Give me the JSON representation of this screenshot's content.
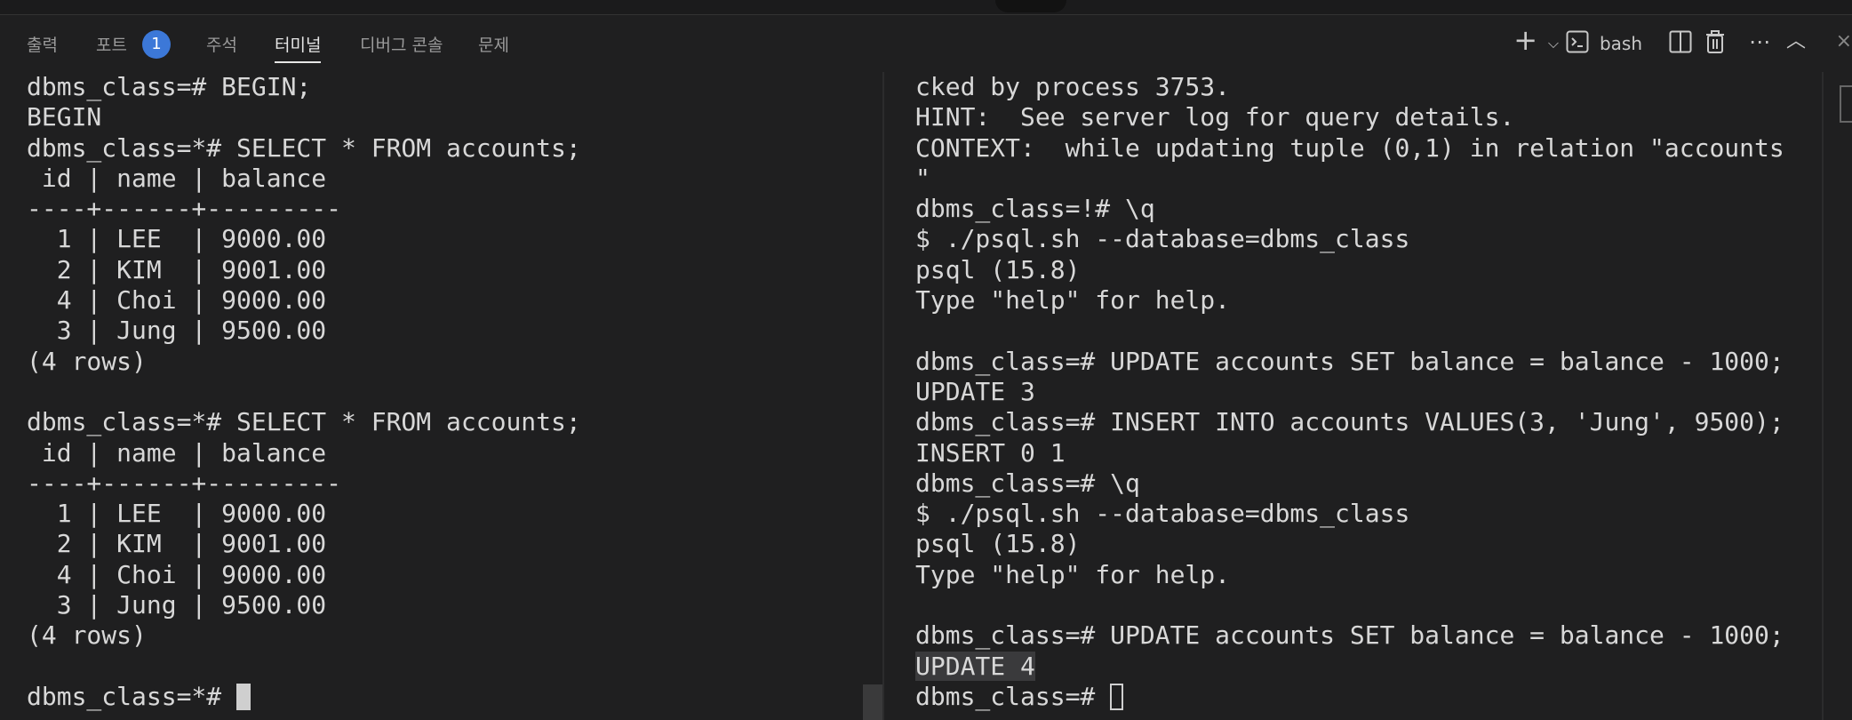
{
  "tabs": [
    {
      "label": "출력"
    },
    {
      "label": "포트"
    },
    {
      "label": "주석"
    },
    {
      "label": "터미널"
    },
    {
      "label": "디버그 콘솔"
    },
    {
      "label": "문제"
    }
  ],
  "ports_badge": "1",
  "active_tab": "터미널",
  "toolbar": {
    "shell_label": "bash",
    "icons": [
      "plus-icon",
      "chevron-down-icon",
      "terminal-icon",
      "split-icon",
      "trash-icon",
      "more-icon",
      "chevron-up-icon",
      "close-icon"
    ]
  },
  "left_terminal": {
    "lines": [
      "dbms_class=# BEGIN;",
      "BEGIN",
      "dbms_class=*# SELECT * FROM accounts;",
      " id | name | balance",
      "----+------+---------",
      "  1 | LEE  | 9000.00",
      "  2 | KIM  | 9001.00",
      "  4 | Choi | 9000.00",
      "  3 | Jung | 9500.00",
      "(4 rows)",
      "",
      "dbms_class=*# SELECT * FROM accounts;",
      " id | name | balance",
      "----+------+---------",
      "  1 | LEE  | 9000.00",
      "  2 | KIM  | 9001.00",
      "  4 | Choi | 9000.00",
      "  3 | Jung | 9500.00",
      "(4 rows)",
      ""
    ],
    "prompt": "dbms_class=*# "
  },
  "right_terminal": {
    "lines": [
      "cked by process 3753.",
      "HINT:  See server log for query details.",
      "CONTEXT:  while updating tuple (0,1) in relation \"accounts",
      "\"",
      "dbms_class=!# \\q",
      "$ ./psql.sh --database=dbms_class",
      "psql (15.8)",
      "Type \"help\" for help.",
      "",
      "dbms_class=# UPDATE accounts SET balance = balance - 1000;",
      "UPDATE 3",
      "dbms_class=# INSERT INTO accounts VALUES(3, 'Jung', 9500);",
      "INSERT 0 1",
      "dbms_class=# \\q",
      "$ ./psql.sh --database=dbms_class",
      "psql (15.8)",
      "Type \"help\" for help.",
      "",
      "dbms_class=# UPDATE accounts SET balance = balance - 1000;"
    ],
    "highlighted_line": "UPDATE 4",
    "prompt": "dbms_class=# "
  }
}
